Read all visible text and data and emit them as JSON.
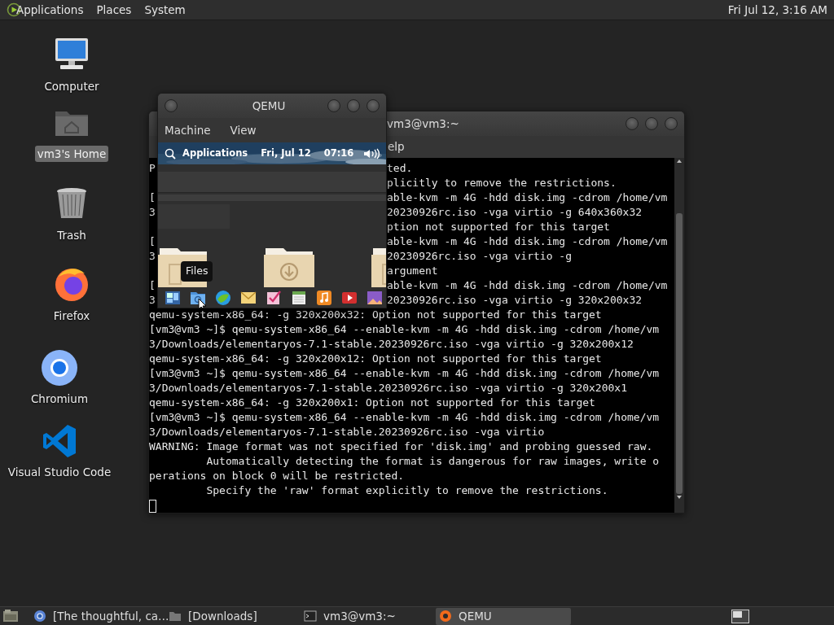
{
  "top_panel": {
    "menus": [
      "Applications",
      "Places",
      "System"
    ],
    "clock": "Fri Jul 12, 3:16 AM"
  },
  "desktop_icons": [
    {
      "label": "Computer",
      "kind": "computer",
      "selected": false
    },
    {
      "label": "vm3's Home",
      "kind": "home",
      "selected": true
    },
    {
      "label": "Trash",
      "kind": "trash",
      "selected": false
    },
    {
      "label": "Firefox",
      "kind": "firefox",
      "selected": false
    },
    {
      "label": "Chromium",
      "kind": "chromium",
      "selected": false
    },
    {
      "label": "Visual Studio Code",
      "kind": "code",
      "selected": false
    }
  ],
  "terminal": {
    "title": "vm3@vm3:~",
    "menu": [
      "elp"
    ],
    "lines": [
      {
        "kind": "split",
        "head": "P",
        "tail": "ted."
      },
      {
        "kind": "split",
        "tail": "plicitly to remove the restrictions."
      },
      {
        "kind": "split",
        "head": "[",
        "tail": "able-kvm -m 4G -hdd disk.img -cdrom /home/vm"
      },
      {
        "kind": "split",
        "head": "3",
        "tail": "20230926rc.iso -vga virtio -g 640x360x32"
      },
      {
        "kind": "split",
        "tail": "ption not supported for this target"
      },
      {
        "kind": "split",
        "head": "[",
        "tail": "able-kvm -m 4G -hdd disk.img -cdrom /home/vm"
      },
      {
        "kind": "split",
        "head": "3",
        "tail": "20230926rc.iso -vga virtio -g"
      },
      {
        "kind": "split",
        "tail": "argument"
      },
      {
        "kind": "split",
        "head": "[",
        "tail": "able-kvm -m 4G -hdd disk.img -cdrom /home/vm"
      },
      {
        "kind": "split",
        "head": "3",
        "tail": "20230926rc.iso -vga virtio -g 320x200x32"
      },
      {
        "kind": "full",
        "text": "qemu-system-x86_64: -g 320x200x32: Option not supported for this target"
      },
      {
        "kind": "full",
        "text": "[vm3@vm3 ~]$ qemu-system-x86_64 --enable-kvm -m 4G -hdd disk.img -cdrom /home/vm"
      },
      {
        "kind": "full",
        "text": "3/Downloads/elementaryos-7.1-stable.20230926rc.iso -vga virtio -g 320x200x12"
      },
      {
        "kind": "full",
        "text": "qemu-system-x86_64: -g 320x200x12: Option not supported for this target"
      },
      {
        "kind": "full",
        "text": "[vm3@vm3 ~]$ qemu-system-x86_64 --enable-kvm -m 4G -hdd disk.img -cdrom /home/vm"
      },
      {
        "kind": "full",
        "text": "3/Downloads/elementaryos-7.1-stable.20230926rc.iso -vga virtio -g 320x200x1"
      },
      {
        "kind": "full",
        "text": "qemu-system-x86_64: -g 320x200x1: Option not supported for this target"
      },
      {
        "kind": "full",
        "text": "[vm3@vm3 ~]$ qemu-system-x86_64 --enable-kvm -m 4G -hdd disk.img -cdrom /home/vm"
      },
      {
        "kind": "full",
        "text": "3/Downloads/elementaryos-7.1-stable.20230926rc.iso -vga virtio"
      },
      {
        "kind": "full",
        "text": "WARNING: Image format was not specified for 'disk.img' and probing guessed raw."
      },
      {
        "kind": "full",
        "text": "         Automatically detecting the format is dangerous for raw images, write o"
      },
      {
        "kind": "full",
        "text": "perations on block 0 will be restricted."
      },
      {
        "kind": "full",
        "text": "         Specify the 'raw' format explicitly to remove the restrictions."
      },
      {
        "kind": "cursor"
      }
    ]
  },
  "qemu": {
    "title": "QEMU",
    "menus": [
      "Machine",
      "View"
    ],
    "guest": {
      "panel": {
        "apps": "Applications",
        "date": "Fri, Jul 12",
        "time": "07:16"
      },
      "tooltip": "Files"
    }
  },
  "taskbar": {
    "tasks": [
      {
        "label": "[The thoughtful, ca…",
        "kind": "browser",
        "selected": false
      },
      {
        "label": "[Downloads]",
        "kind": "folder",
        "selected": false
      },
      {
        "label": "vm3@vm3:~",
        "kind": "terminal",
        "selected": false
      },
      {
        "label": "QEMU",
        "kind": "qemu",
        "selected": true
      }
    ]
  }
}
